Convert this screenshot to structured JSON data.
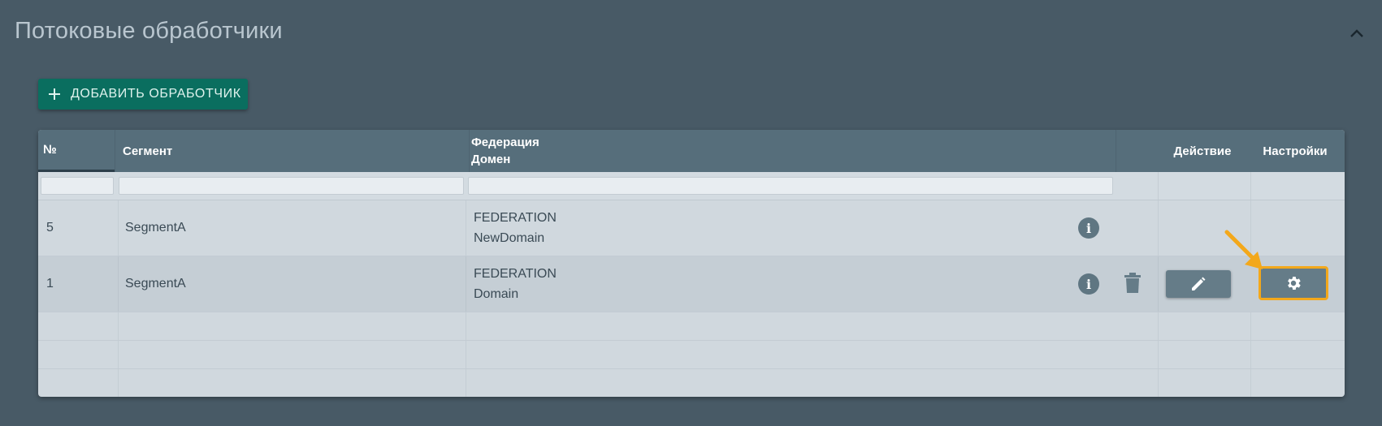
{
  "section": {
    "title": "Потоковые обработчики"
  },
  "add_button": {
    "label": "ДОБАВИТЬ ОБРАБОТЧИК"
  },
  "table": {
    "headers": {
      "number": "№",
      "segment": "Сегмент",
      "federation": "Федерация",
      "domain": "Домен",
      "action": "Действие",
      "settings": "Настройки"
    },
    "rows": [
      {
        "number": "5",
        "segment": "SegmentA",
        "federation": "FEDERATION",
        "domain": "NewDomain"
      },
      {
        "number": "1",
        "segment": "SegmentA",
        "federation": "FEDERATION",
        "domain": "Domain"
      }
    ]
  },
  "colors": {
    "background": "#485a66",
    "header": "#566e7b",
    "add_button": "#0a6e5f",
    "highlight": "#f3a81b"
  },
  "icons": [
    "chevron-up-icon",
    "plus-icon",
    "info-icon",
    "trash-icon",
    "pencil-icon",
    "gear-icon",
    "arrow-annotation-icon"
  ]
}
